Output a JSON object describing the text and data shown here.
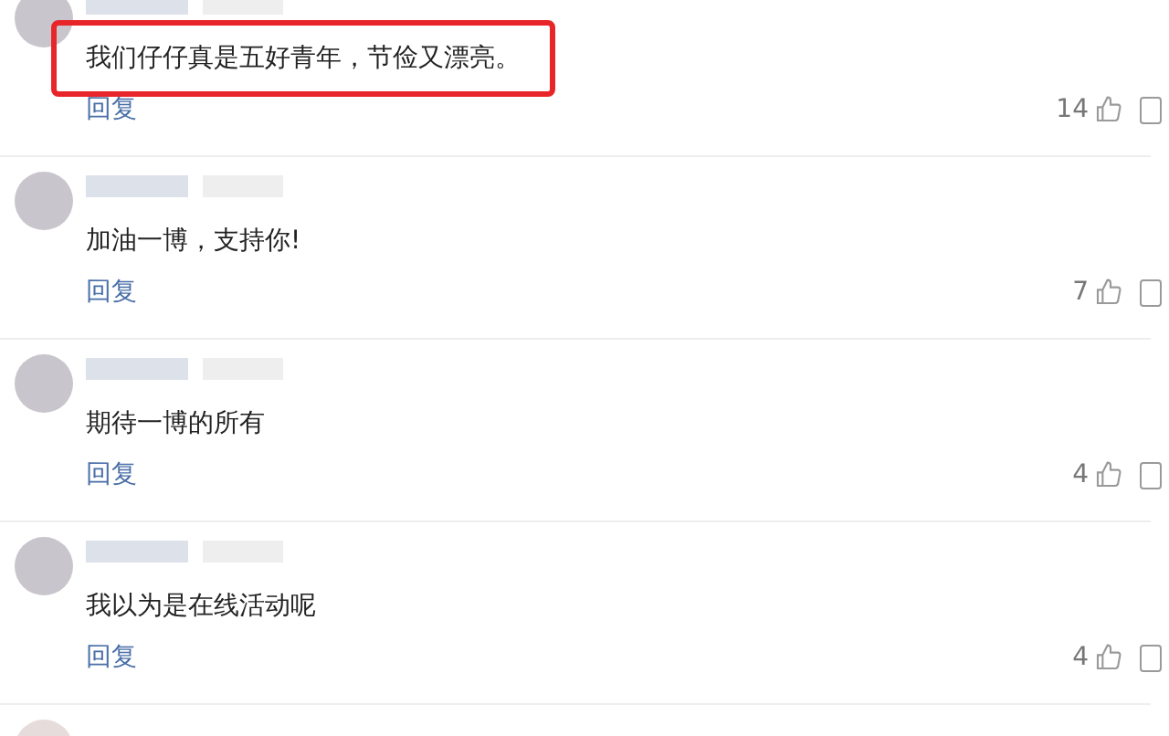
{
  "comments": [
    {
      "text": "我们仔仔真是五好青年，节俭又漂亮。",
      "highlighted": true,
      "reply": "回复",
      "likes": "14"
    },
    {
      "text": "加油一博，支持你!",
      "highlighted": false,
      "reply": "回复",
      "likes": "7"
    },
    {
      "text": "期待一博的所有",
      "highlighted": false,
      "reply": "回复",
      "likes": "4"
    },
    {
      "text": "我以为是在线活动呢",
      "highlighted": false,
      "reply": "回复",
      "likes": "4"
    }
  ]
}
